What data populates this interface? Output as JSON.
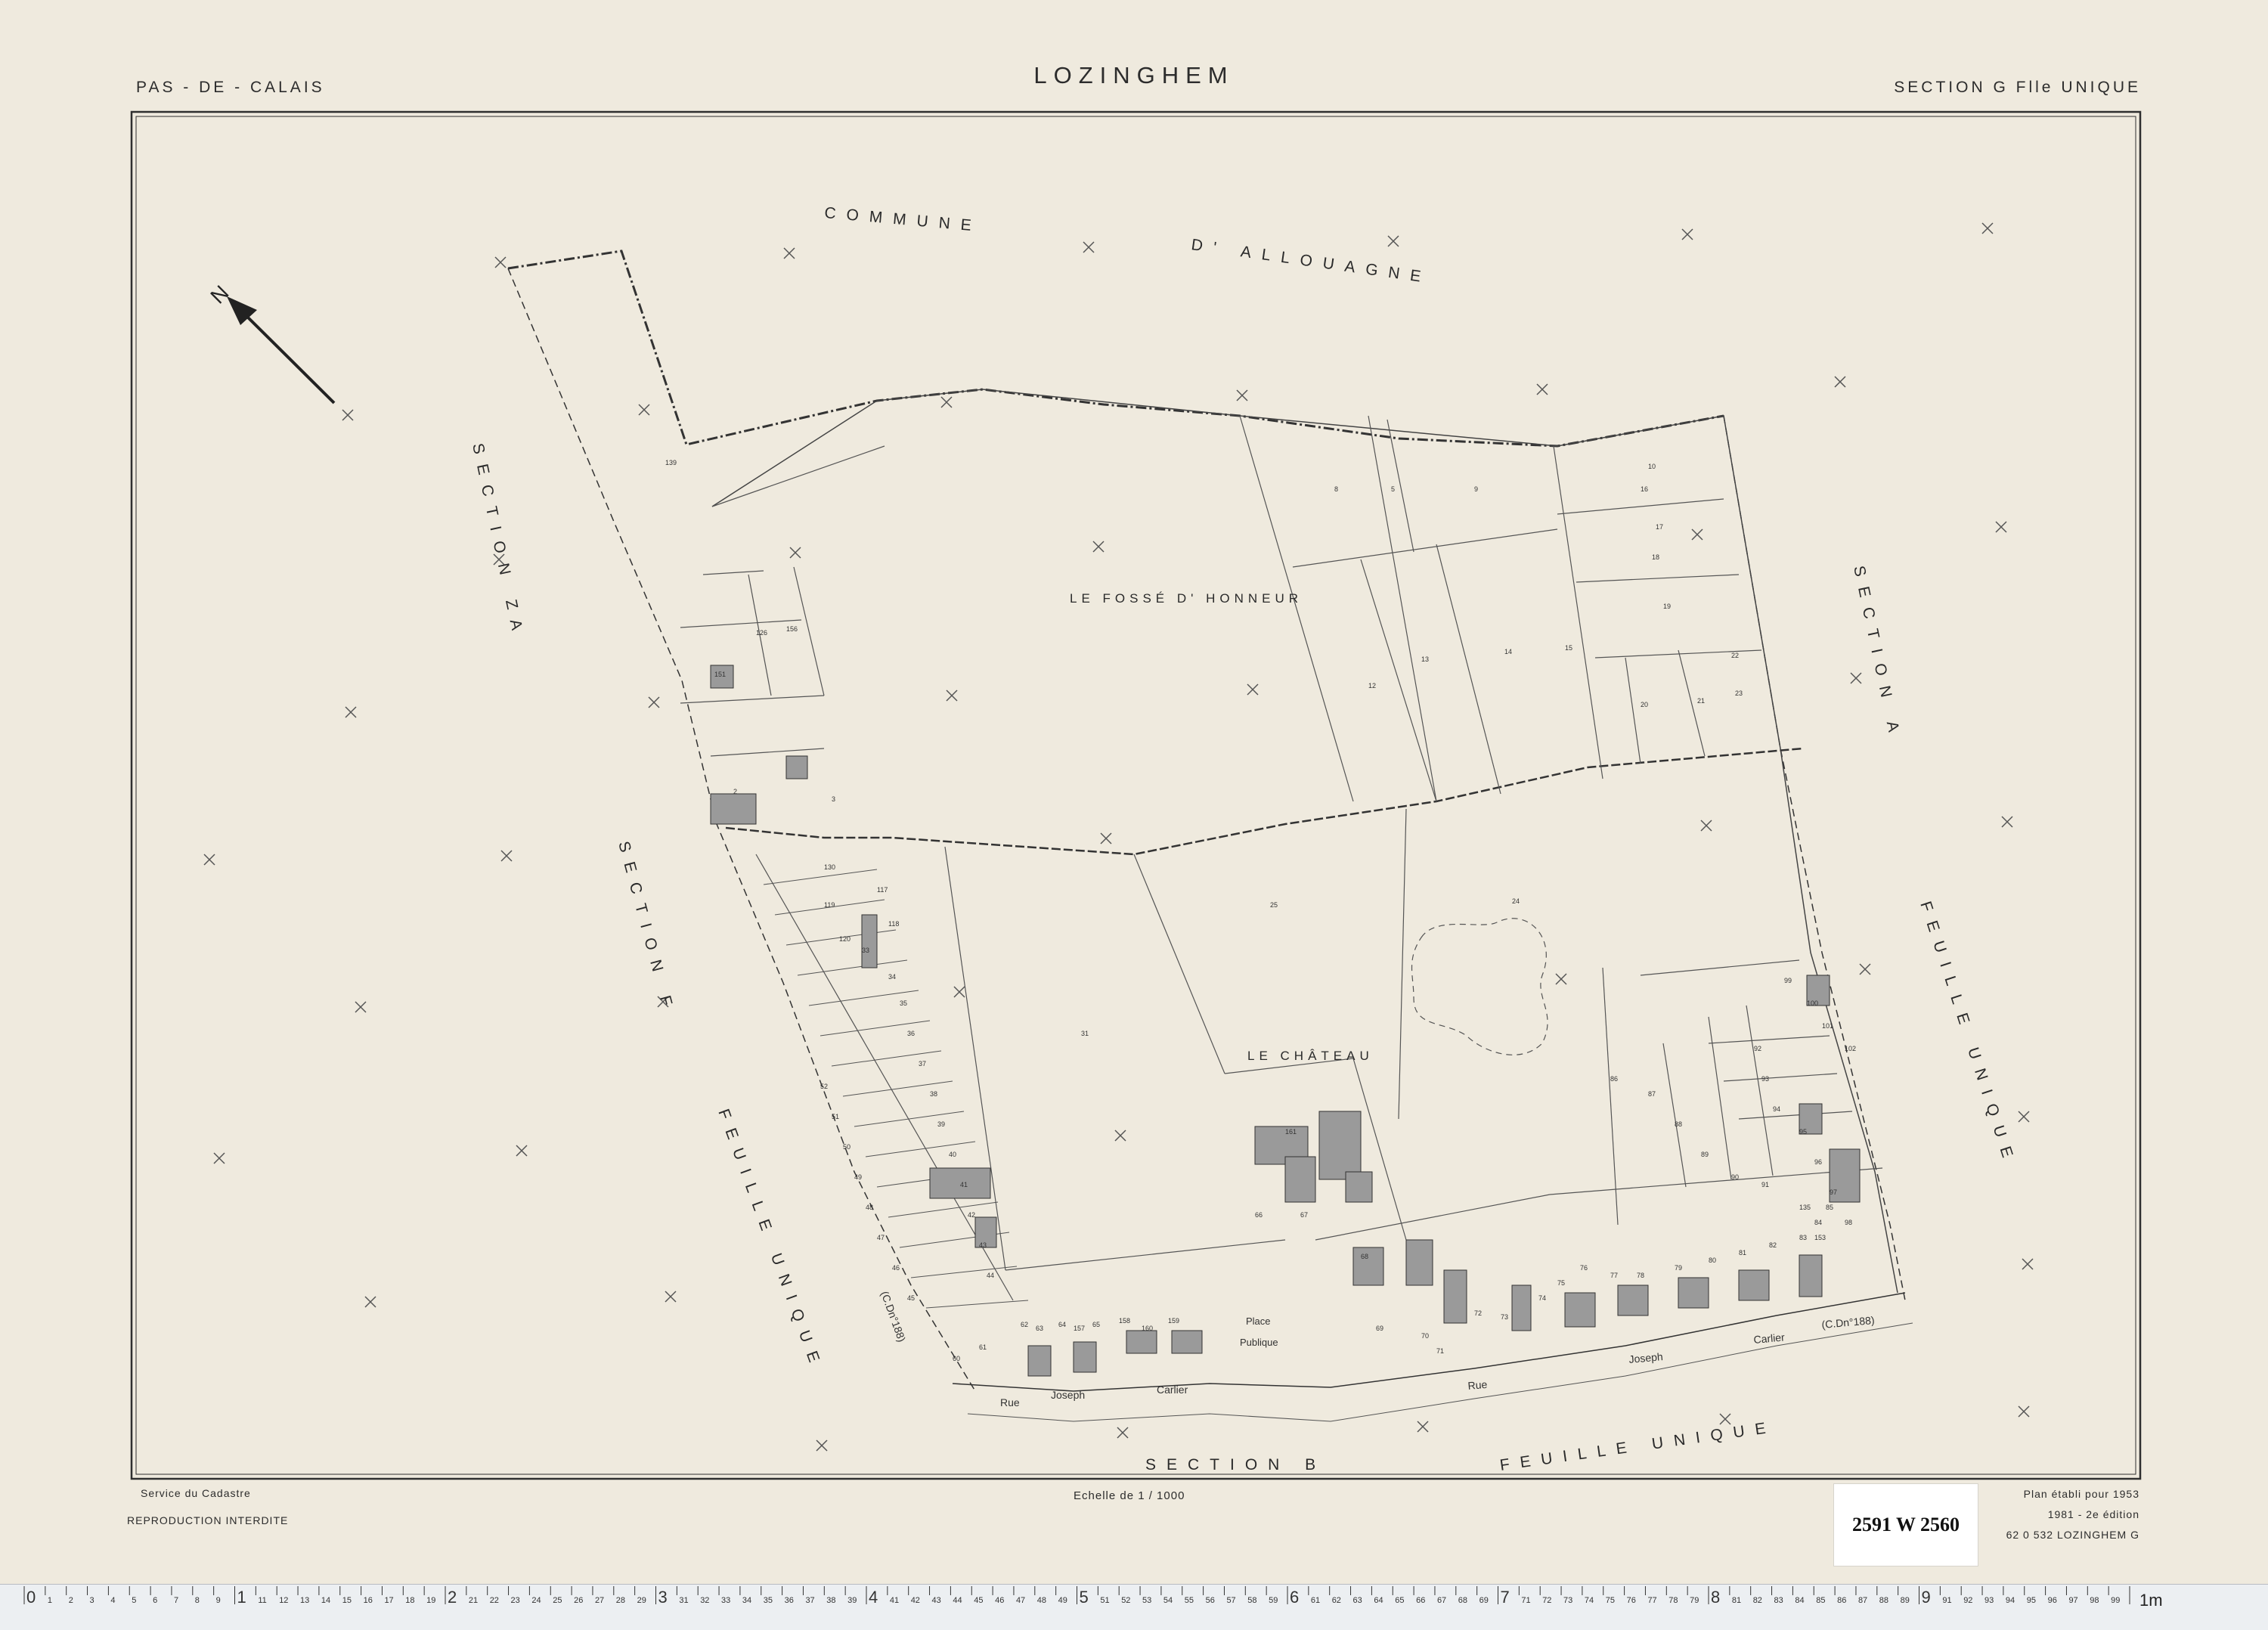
{
  "header": {
    "department": "PAS - DE - CALAIS",
    "title": "LOZINGHEM",
    "section": "SECTION G Flle UNIQUE"
  },
  "map": {
    "neighbour_labels": {
      "commune_1": "COMMUNE",
      "commune_2": "D' ALLOUAGNE",
      "section_za": "SECTION ZA",
      "section_a": "SECTION A",
      "section_f": "SECTION F",
      "feuille_unique_left": "FEUILLE UNIQUE",
      "feuille_unique_right": "FEUILLE UNIQUE",
      "section_b": "SECTION B",
      "feuille_unique_bottom": "FEUILLE UNIQUE"
    },
    "place_labels": {
      "fosse": "LE FOSSÉ D' HONNEUR",
      "chateau": "LE CHÂTEAU",
      "place_1": "Place",
      "place_2": "Publique"
    },
    "street_labels": {
      "rue_left": "Rue",
      "joseph_left": "Joseph",
      "carlier_left": "Carlier",
      "rue_right": "Rue",
      "joseph_right": "Joseph",
      "carlier_right": "Carlier",
      "chemin_right": "(C.Dn°188)",
      "chemin_left": "(C.Dn°188)"
    },
    "parcel_numbers": [
      "139",
      "126",
      "156",
      "151",
      "2",
      "3",
      "8",
      "5",
      "9",
      "10",
      "12",
      "13",
      "14",
      "15",
      "16",
      "17",
      "18",
      "19",
      "20",
      "21",
      "22",
      "23",
      "24",
      "25",
      "31",
      "33",
      "34",
      "35",
      "36",
      "37",
      "38",
      "39",
      "40",
      "41",
      "42",
      "43",
      "44",
      "45",
      "46",
      "47",
      "48",
      "49",
      "50",
      "51",
      "52",
      "60",
      "61",
      "62",
      "63",
      "64",
      "65",
      "66",
      "67",
      "68",
      "69",
      "70",
      "71",
      "72",
      "73",
      "74",
      "75",
      "76",
      "77",
      "78",
      "79",
      "80",
      "81",
      "82",
      "83",
      "84",
      "85",
      "86",
      "87",
      "88",
      "89",
      "90",
      "91",
      "92",
      "93",
      "94",
      "95",
      "96",
      "97",
      "98",
      "99",
      "100",
      "101",
      "102",
      "117",
      "118",
      "119",
      "120",
      "130",
      "135",
      "153",
      "157",
      "158",
      "159",
      "160",
      "161"
    ],
    "north_label": "N"
  },
  "footer": {
    "service": "Service du Cadastre",
    "reproduction": "REPRODUCTION INTERDITE",
    "scale": "Echelle de 1 / 1000",
    "plan_line_1": "Plan établi pour 1953",
    "plan_line_2": "1981 - 2e édition",
    "reference": "62 0 532 LOZINGHEM G"
  },
  "archive_label": "2591 W 2560",
  "ruler": {
    "unit_end": "1m"
  }
}
